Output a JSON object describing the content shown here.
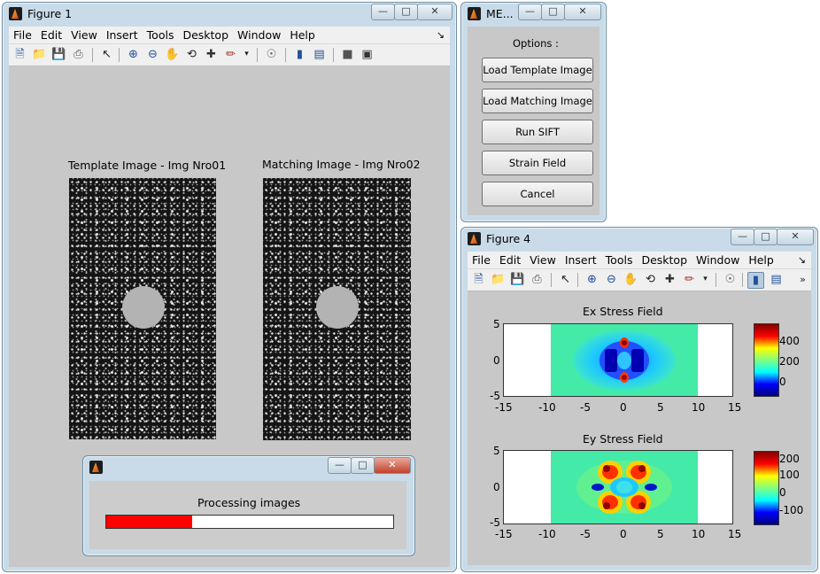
{
  "figure1": {
    "title": "Figure 1",
    "menu": [
      "File",
      "Edit",
      "View",
      "Insert",
      "Tools",
      "Desktop",
      "Window",
      "Help"
    ],
    "template_label": "Template Image - Img Nro01",
    "matching_label": "Matching Image - Img Nro02"
  },
  "progress": {
    "message": "Processing images",
    "fraction": 0.3,
    "bar_color": "#ff0000"
  },
  "menu_window": {
    "title": "ME...",
    "options_label": "Options :",
    "buttons": [
      "Load Template Image",
      "Load Matching Image",
      "Run SIFT",
      "Strain Field",
      "Cancel"
    ]
  },
  "figure4": {
    "title": "Figure 4",
    "menu": [
      "File",
      "Edit",
      "View",
      "Insert",
      "Tools",
      "Desktop",
      "Window",
      "Help"
    ],
    "plot1": {
      "title": "Ex Stress Field",
      "yticks": [
        "5",
        "0",
        "-5"
      ],
      "xticks": [
        "-15",
        "-10",
        "-5",
        "0",
        "5",
        "10",
        "15"
      ],
      "cbar_ticks": [
        "400",
        "200",
        "0"
      ]
    },
    "plot2": {
      "title": "Ey Stress Field",
      "yticks": [
        "5",
        "0",
        "-5"
      ],
      "xticks": [
        "-15",
        "-10",
        "-5",
        "0",
        "5",
        "10",
        "15"
      ],
      "cbar_ticks": [
        "200",
        "100",
        "0",
        "-100"
      ]
    }
  },
  "colors": {
    "window_frame": "#c9dbe8",
    "figure_bg": "#c8c8c8",
    "close_button": "#c0412d"
  }
}
